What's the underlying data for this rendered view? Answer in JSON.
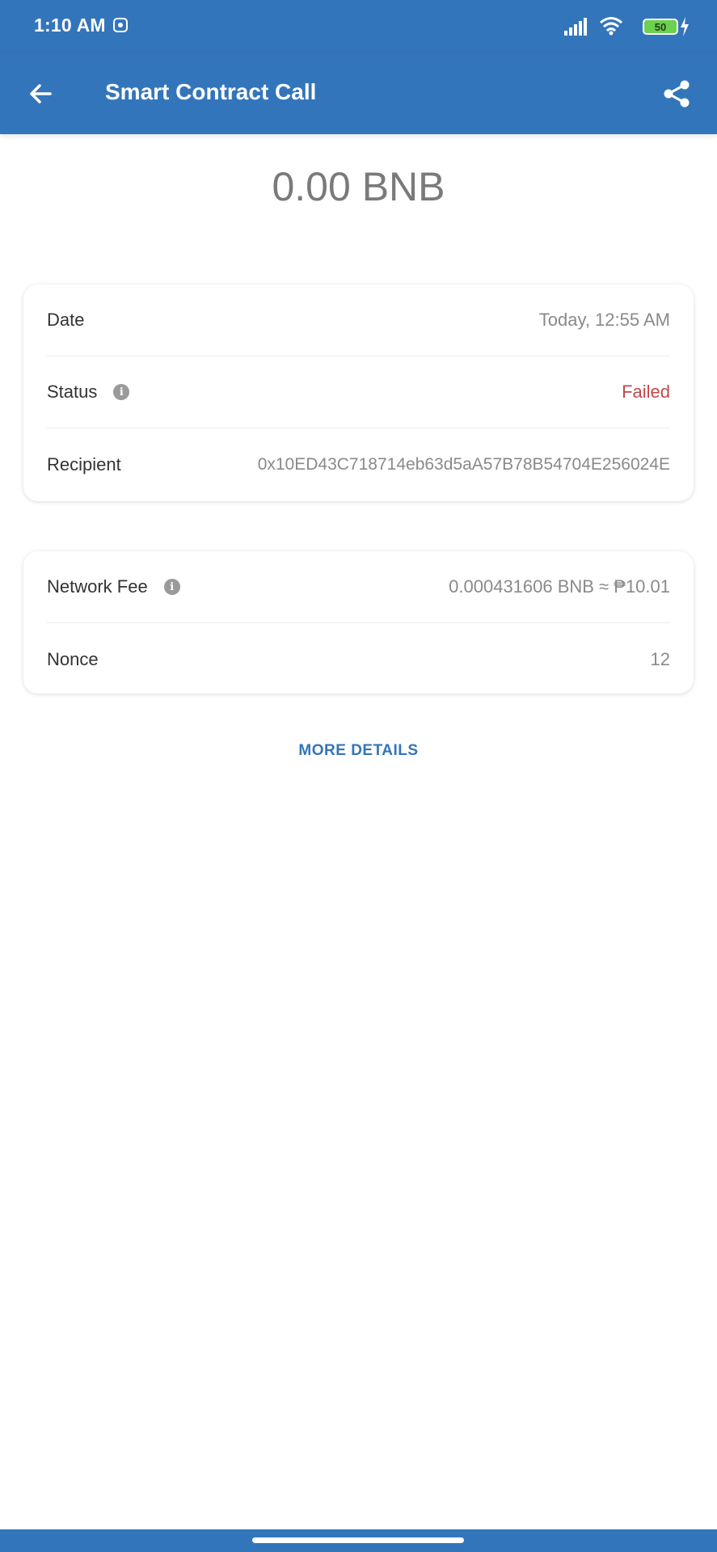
{
  "status_bar": {
    "time": "1:10 AM",
    "battery_level": "50",
    "icons": [
      "notification-icon",
      "signal-icon",
      "wifi-icon",
      "battery-icon",
      "charging-icon"
    ]
  },
  "app_bar": {
    "title": "Smart Contract Call",
    "back_icon": "back-arrow-icon",
    "share_icon": "share-icon"
  },
  "amount": "0.00 BNB",
  "details": {
    "date_label": "Date",
    "date_value": "Today, 12:55 AM",
    "status_label": "Status",
    "status_value": "Failed",
    "recipient_label": "Recipient",
    "recipient_value": "0x10ED43C718714eb63d5aA57B78B54704E256024E"
  },
  "fees": {
    "network_fee_label": "Network Fee",
    "network_fee_value": "0.000431606 BNB ≈ ₱10.01",
    "nonce_label": "Nonce",
    "nonce_value": "12"
  },
  "more_details_label": "MORE DETAILS",
  "colors": {
    "primary": "#3375bb",
    "failed": "#c0494b",
    "battery": "#6bd14f"
  }
}
